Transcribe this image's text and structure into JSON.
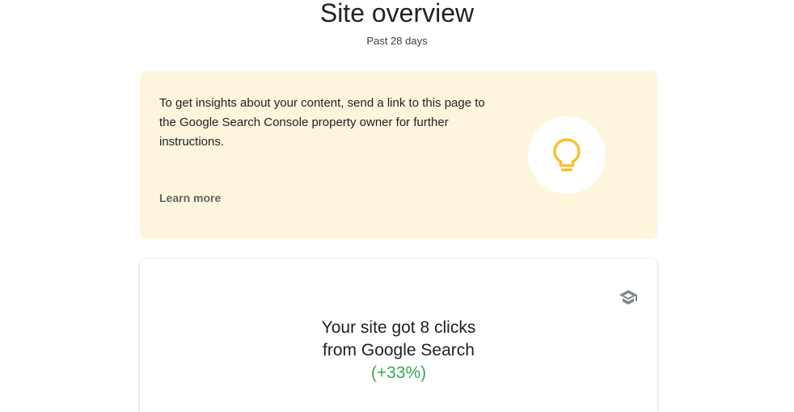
{
  "header": {
    "title": "Site overview",
    "subtitle": "Past 28 days"
  },
  "insight_card": {
    "message": "To get insights about your content, send a link to this page to the Google Search Console property owner for further instructions.",
    "learn_more_label": "Learn more",
    "icon": "lightbulb-icon",
    "background_color": "#fdf6dd",
    "icon_color": "#fbc02d"
  },
  "clicks_card": {
    "line1": "Your site got 8 clicks",
    "line2": "from Google Search",
    "change": "(+33%)",
    "change_color": "#34a853",
    "icon": "school-cap-icon"
  }
}
